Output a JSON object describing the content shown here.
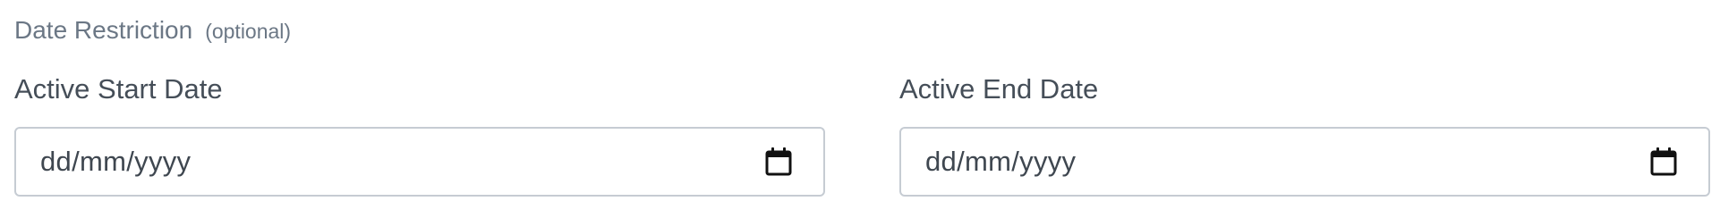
{
  "section": {
    "title": "Date Restriction",
    "optional_label": "(optional)"
  },
  "fields": {
    "start": {
      "label": "Active Start Date",
      "placeholder": "dd/mm/yyyy",
      "icon": "calendar-icon"
    },
    "end": {
      "label": "Active End Date",
      "placeholder": "dd/mm/yyyy",
      "icon": "calendar-icon"
    }
  },
  "colors": {
    "section_text": "#6b7785",
    "label_text": "#454e58",
    "input_border": "#c6ccd3",
    "input_text": "#3f4750"
  }
}
